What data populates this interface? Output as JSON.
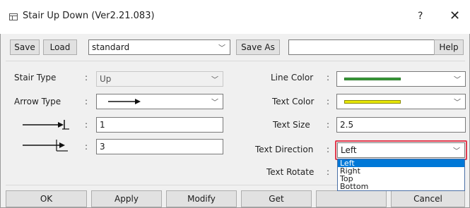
{
  "window": {
    "title": "Stair Up Down (Ver2.21.083)",
    "help_glyph": "?",
    "close_glyph": "✕"
  },
  "toolbar": {
    "save_label": "Save",
    "load_label": "Load",
    "preset_value": "standard",
    "save_as_label": "Save As",
    "save_as_value": "",
    "help_label": "Help"
  },
  "left": {
    "stair_type_label": "Stair Type",
    "stair_type_value": "Up",
    "arrow_type_label": "Arrow Type",
    "field1_value": "1",
    "field2_value": "3",
    "colon": ":"
  },
  "right": {
    "line_color_label": "Line Color",
    "text_color_label": "Text Color",
    "text_size_label": "Text Size",
    "text_size_value": "2.5",
    "text_direction_label": "Text Direction",
    "text_direction_value": "Left",
    "text_rotate_label": "Text Rotate",
    "direction_options": [
      "Left",
      "Right",
      "Top",
      "Bottom"
    ],
    "line_color_hex": "#3a9a3a",
    "text_color_hex": "#d6d600"
  },
  "footer": {
    "ok_label": "OK",
    "apply_label": "Apply",
    "modify_label": "Modify",
    "get_label": "Get",
    "cancel_label": "Cancel"
  }
}
